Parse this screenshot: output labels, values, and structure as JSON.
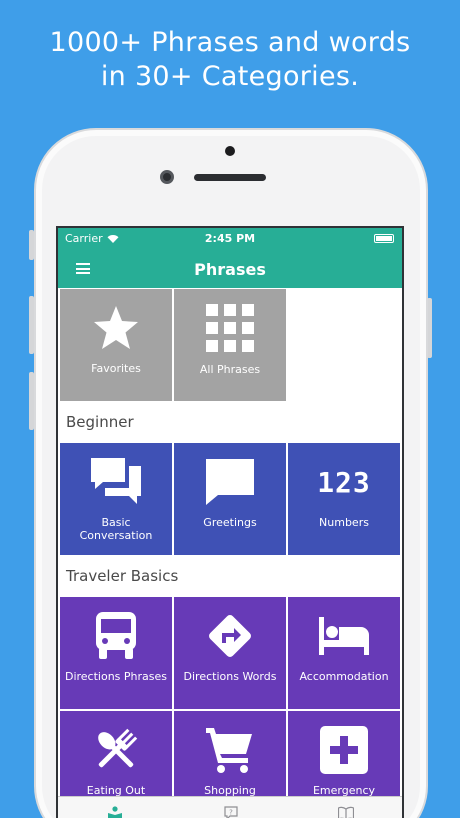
{
  "headline": {
    "line1": "1000+ Phrases and words",
    "line2": "in 30+ Categories."
  },
  "status": {
    "carrier": "Carrier",
    "time": "2:45 PM"
  },
  "navbar": {
    "title": "Phrases"
  },
  "top_tiles": [
    {
      "label": "Favorites",
      "icon": "star-icon"
    },
    {
      "label": "All Phrases",
      "icon": "grid-icon"
    }
  ],
  "sections": [
    {
      "title": "Beginner",
      "tiles": [
        {
          "label": "Basic\nConversation",
          "icon": "chat-bubbles-icon"
        },
        {
          "label": "Greetings",
          "icon": "speech-bubble-icon"
        },
        {
          "label": "Numbers",
          "icon": "numbers-123-icon",
          "glyph": "123"
        }
      ]
    },
    {
      "title": "Traveler Basics",
      "tiles": [
        {
          "label": "Directions Phrases",
          "icon": "bus-icon"
        },
        {
          "label": "Directions Words",
          "icon": "direction-sign-icon"
        },
        {
          "label": "Accommodation",
          "icon": "bed-icon"
        },
        {
          "label": "Eating Out",
          "icon": "fork-spoon-icon"
        },
        {
          "label": "Shopping",
          "icon": "shopping-cart-icon"
        },
        {
          "label": "Emergency",
          "icon": "plus-cross-icon"
        }
      ]
    }
  ],
  "tabbar": [
    {
      "name": "phrases-tab",
      "icon": "reader-icon"
    },
    {
      "name": "quiz-tab",
      "icon": "question-bubble-icon"
    },
    {
      "name": "dictionary-tab",
      "icon": "book-icon"
    }
  ],
  "colors": {
    "background": "#3f9ee9",
    "accent": "#27ae96",
    "tile_gray": "#a3a3a3",
    "tile_blue": "#3f51b5",
    "tile_purple": "#673ab7"
  }
}
